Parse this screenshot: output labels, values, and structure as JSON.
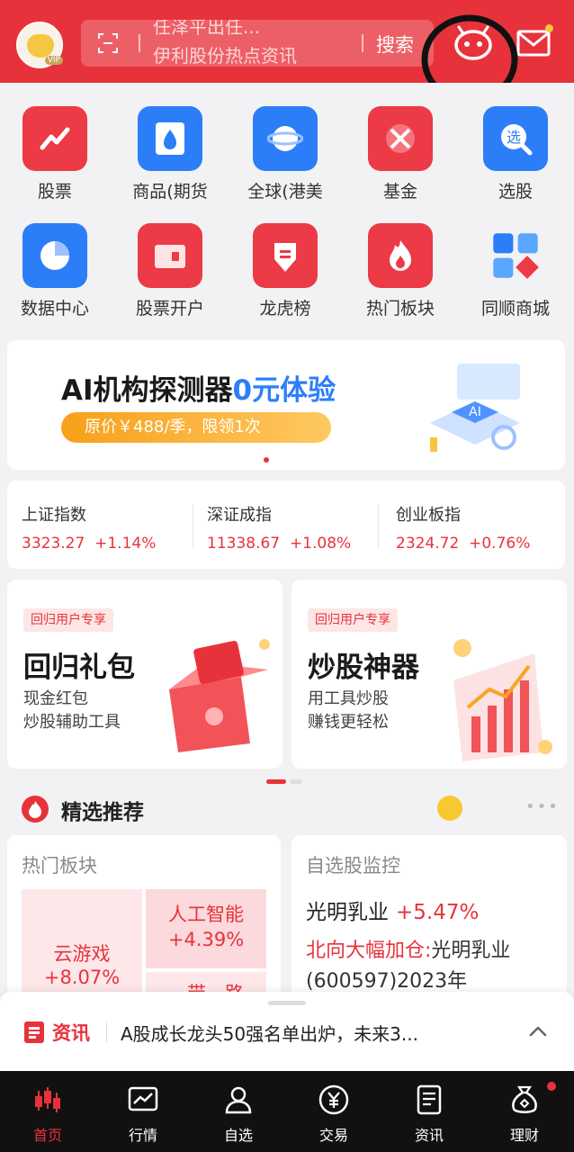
{
  "header": {
    "search_line1": "任泽平出任...",
    "search_line2": "伊利股份热点资讯",
    "search_button": "搜索",
    "avatar_badge": "VIP"
  },
  "grid": {
    "items": [
      {
        "label": "股票",
        "icon": "stock-trend-icon",
        "color": "#ec3a46"
      },
      {
        "label": "商品(期货",
        "icon": "commodity-drop-icon",
        "color": "#2c7ef8"
      },
      {
        "label": "全球(港美",
        "icon": "globe-planet-icon",
        "color": "#2c7ef8"
      },
      {
        "label": "基金",
        "icon": "fund-icon",
        "color": "#ec3a46"
      },
      {
        "label": "选股",
        "icon": "stock-picker-icon",
        "color": "#2c7ef8"
      },
      {
        "label": "数据中心",
        "icon": "pie-chart-icon",
        "color": "#2c7ef8"
      },
      {
        "label": "股票开户",
        "icon": "wallet-icon",
        "color": "#ec3a46"
      },
      {
        "label": "龙虎榜",
        "icon": "dragon-tiger-shield-icon",
        "color": "#ec3a46"
      },
      {
        "label": "热门板块",
        "icon": "flame-icon",
        "color": "#ec3a46"
      },
      {
        "label": "同顺商城",
        "icon": "mall-blocks-icon",
        "color": "#2c7ef8"
      }
    ]
  },
  "banner": {
    "title_main": "AI机构探测器",
    "title_accent": "0元体验",
    "pill": "原价￥488/季，限领1次",
    "art_text": "AI"
  },
  "indices": [
    {
      "name": "上证指数",
      "value": "3323.27",
      "change": "+1.14%"
    },
    {
      "name": "深证成指",
      "value": "11338.67",
      "change": "+1.08%"
    },
    {
      "name": "创业板指",
      "value": "2324.72",
      "change": "+0.76%"
    }
  ],
  "promos": [
    {
      "tag": "回归用户专享",
      "title": "回归礼包",
      "sub1": "现金红包",
      "sub2": "炒股辅助工具"
    },
    {
      "tag": "回归用户专享",
      "title": "炒股神器",
      "sub1": "用工具炒股",
      "sub2": "赚钱更轻松"
    }
  ],
  "recommended": {
    "title": "精选推荐",
    "more": "•••",
    "hot_sectors": {
      "header": "热门板块",
      "items": [
        {
          "name": "云游戏",
          "change": "+8.07%"
        },
        {
          "name": "人工智能",
          "change": "+4.39%"
        },
        {
          "name": "一带一路",
          "change": ""
        }
      ]
    },
    "watchlist": {
      "header": "自选股监控",
      "stock": "光明乳业",
      "change": "+5.47%",
      "news_red": "北向大幅加仓:",
      "news_rest": "光明乳业(600597)2023年"
    }
  },
  "news": {
    "label": "资讯",
    "text": "A股成长龙头50强名单出炉，未来3..."
  },
  "tabs": [
    {
      "label": "首页",
      "icon": "candlestick-icon",
      "active": true
    },
    {
      "label": "行情",
      "icon": "market-chart-icon",
      "active": false
    },
    {
      "label": "自选",
      "icon": "user-star-icon",
      "active": false
    },
    {
      "label": "交易",
      "icon": "yuan-coin-icon",
      "active": false
    },
    {
      "label": "资讯",
      "icon": "document-icon",
      "active": false
    },
    {
      "label": "理财",
      "icon": "money-bag-icon",
      "active": false
    }
  ],
  "colors": {
    "brand_red": "#e8323b",
    "accent_blue": "#2d7ff9",
    "tab_bar": "#111111"
  }
}
